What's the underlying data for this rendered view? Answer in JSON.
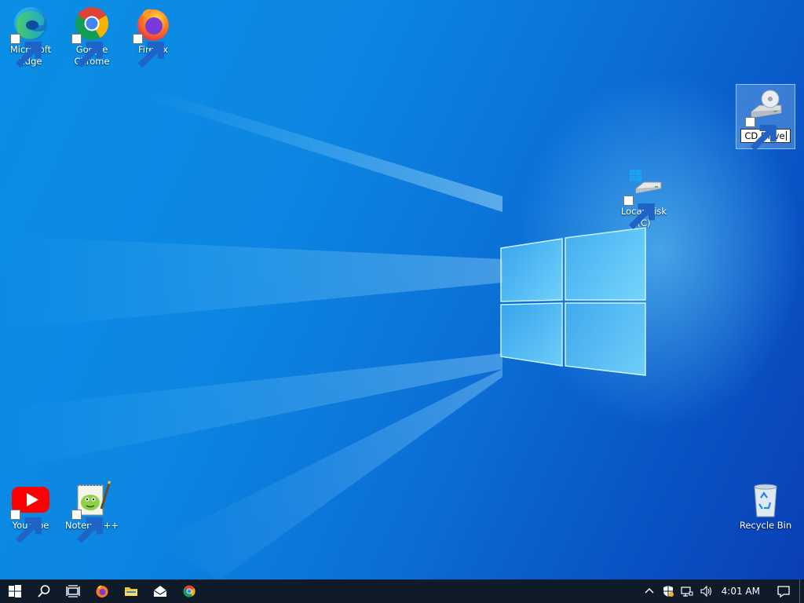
{
  "desktop": {
    "icons": [
      {
        "id": "edge",
        "label": "Microsoft Edge",
        "icon": "edge-icon"
      },
      {
        "id": "chrome",
        "label": "Google Chrome",
        "icon": "chrome-icon"
      },
      {
        "id": "firefox",
        "label": "Firefox",
        "icon": "firefox-icon"
      },
      {
        "id": "cd",
        "label": "CD Drive",
        "icon": "cd-drive-icon",
        "renaming": true
      },
      {
        "id": "localdisk",
        "label": "Local Disk (C)",
        "icon": "hard-drive-icon"
      },
      {
        "id": "youtube",
        "label": "YouTube",
        "icon": "youtube-icon"
      },
      {
        "id": "notepad",
        "label": "Notepad++",
        "icon": "notepad-plus-plus-icon"
      },
      {
        "id": "recycle",
        "label": "Recycle Bin",
        "icon": "recycle-bin-icon"
      }
    ]
  },
  "taskbar": {
    "buttons": [
      "start-button",
      "search-button",
      "task-view-button",
      "firefox-taskbar",
      "file-explorer-taskbar",
      "mail-taskbar",
      "chrome-taskbar"
    ],
    "clock": "4:01 AM",
    "tray_icons": [
      "chevron-up-icon",
      "security-shield-icon",
      "network-icon",
      "volume-icon"
    ],
    "notification_icon": "action-center-icon"
  },
  "colors": {
    "wallpaper_primary": "#0b7bdd",
    "taskbar": "#101b2a",
    "selection": "#99d1ff"
  }
}
